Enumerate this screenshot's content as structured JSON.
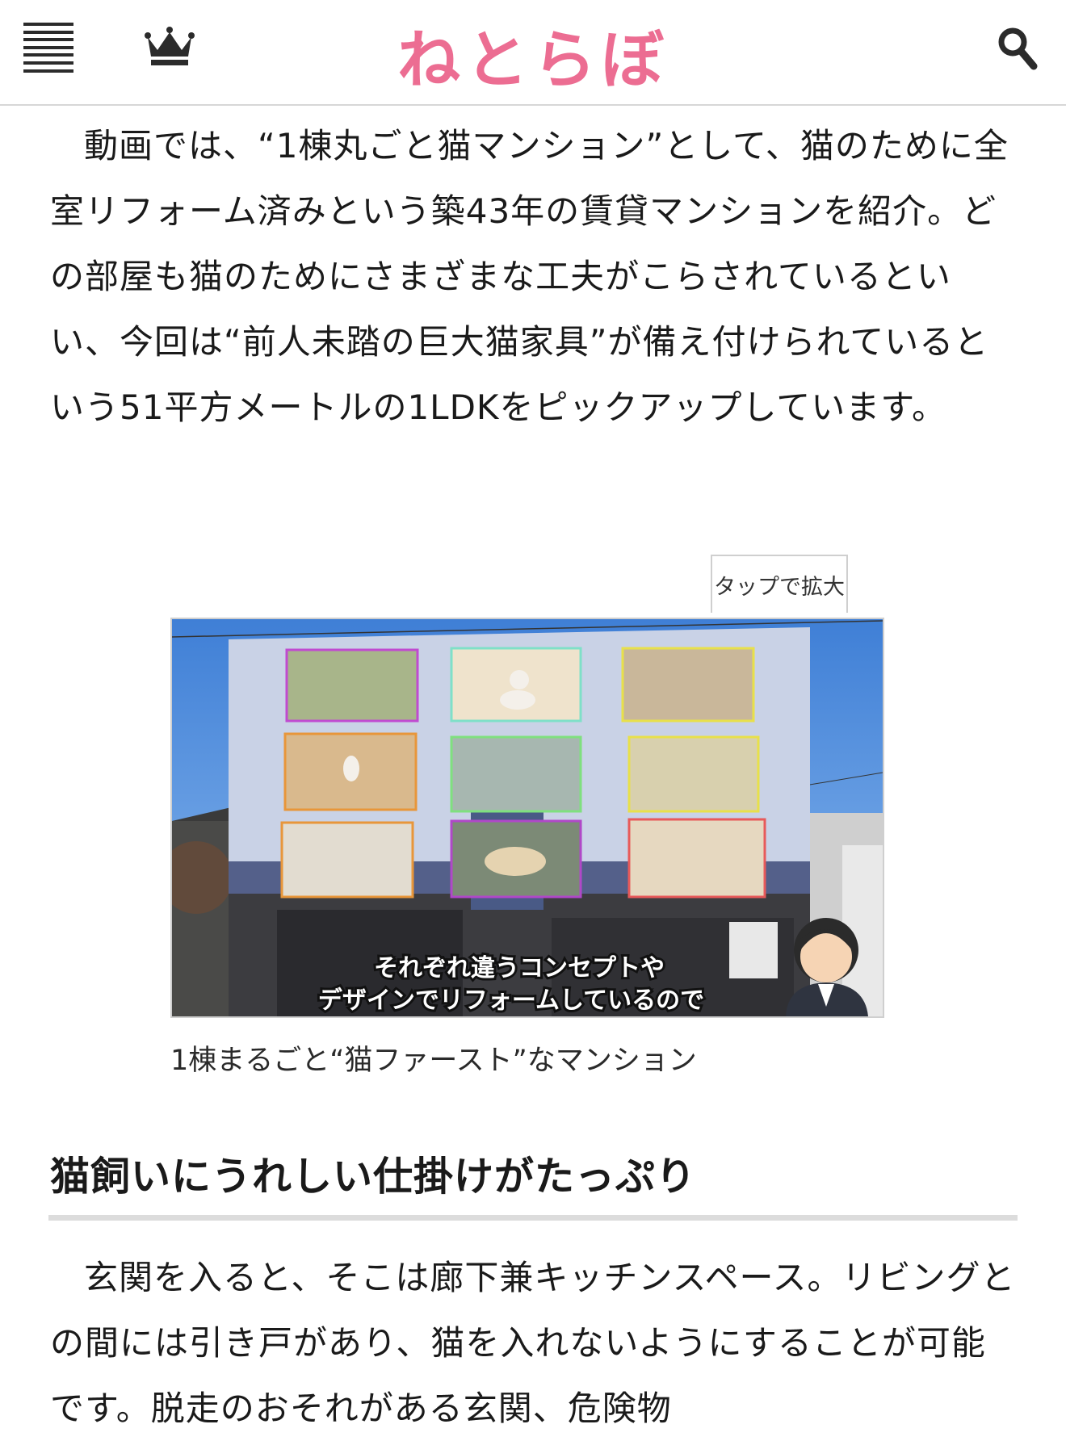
{
  "header": {
    "logo": "ねとらぼ",
    "menu_icon": "hamburger-menu-icon",
    "ranking_icon": "crown-icon",
    "search_icon": "search-icon",
    "logo_color": "#ec6d92"
  },
  "article": {
    "paragraph1": "動画では、“1棟丸ごと猫マンション”として、猫のために全室リフォーム済みという築43年の賃貸マンションを紹介。どの部屋も猫のためにさまざまな工夫がこらされているといい、今回は“前人未踏の巨大猫家具”が備え付けられているという51平方メートルの1LDKをピックアップしています。",
    "figure": {
      "zoom_button": "タップで拡大",
      "image_subtitle_line1": "それぞれ違うコンセプトや",
      "image_subtitle_line2": "デザインでリフォームしているので",
      "caption": "1棟まるごと“猫ファースト”なマンション"
    },
    "section_heading": "猫飼いにうれしい仕掛けがたっぷり",
    "paragraph2": "玄関を入ると、そこは廊下兼キッチンスペース。リビングとの間には引き戸があり、猫を入れないようにすることが可能です。脱走のおそれがある玄関、危険物"
  }
}
